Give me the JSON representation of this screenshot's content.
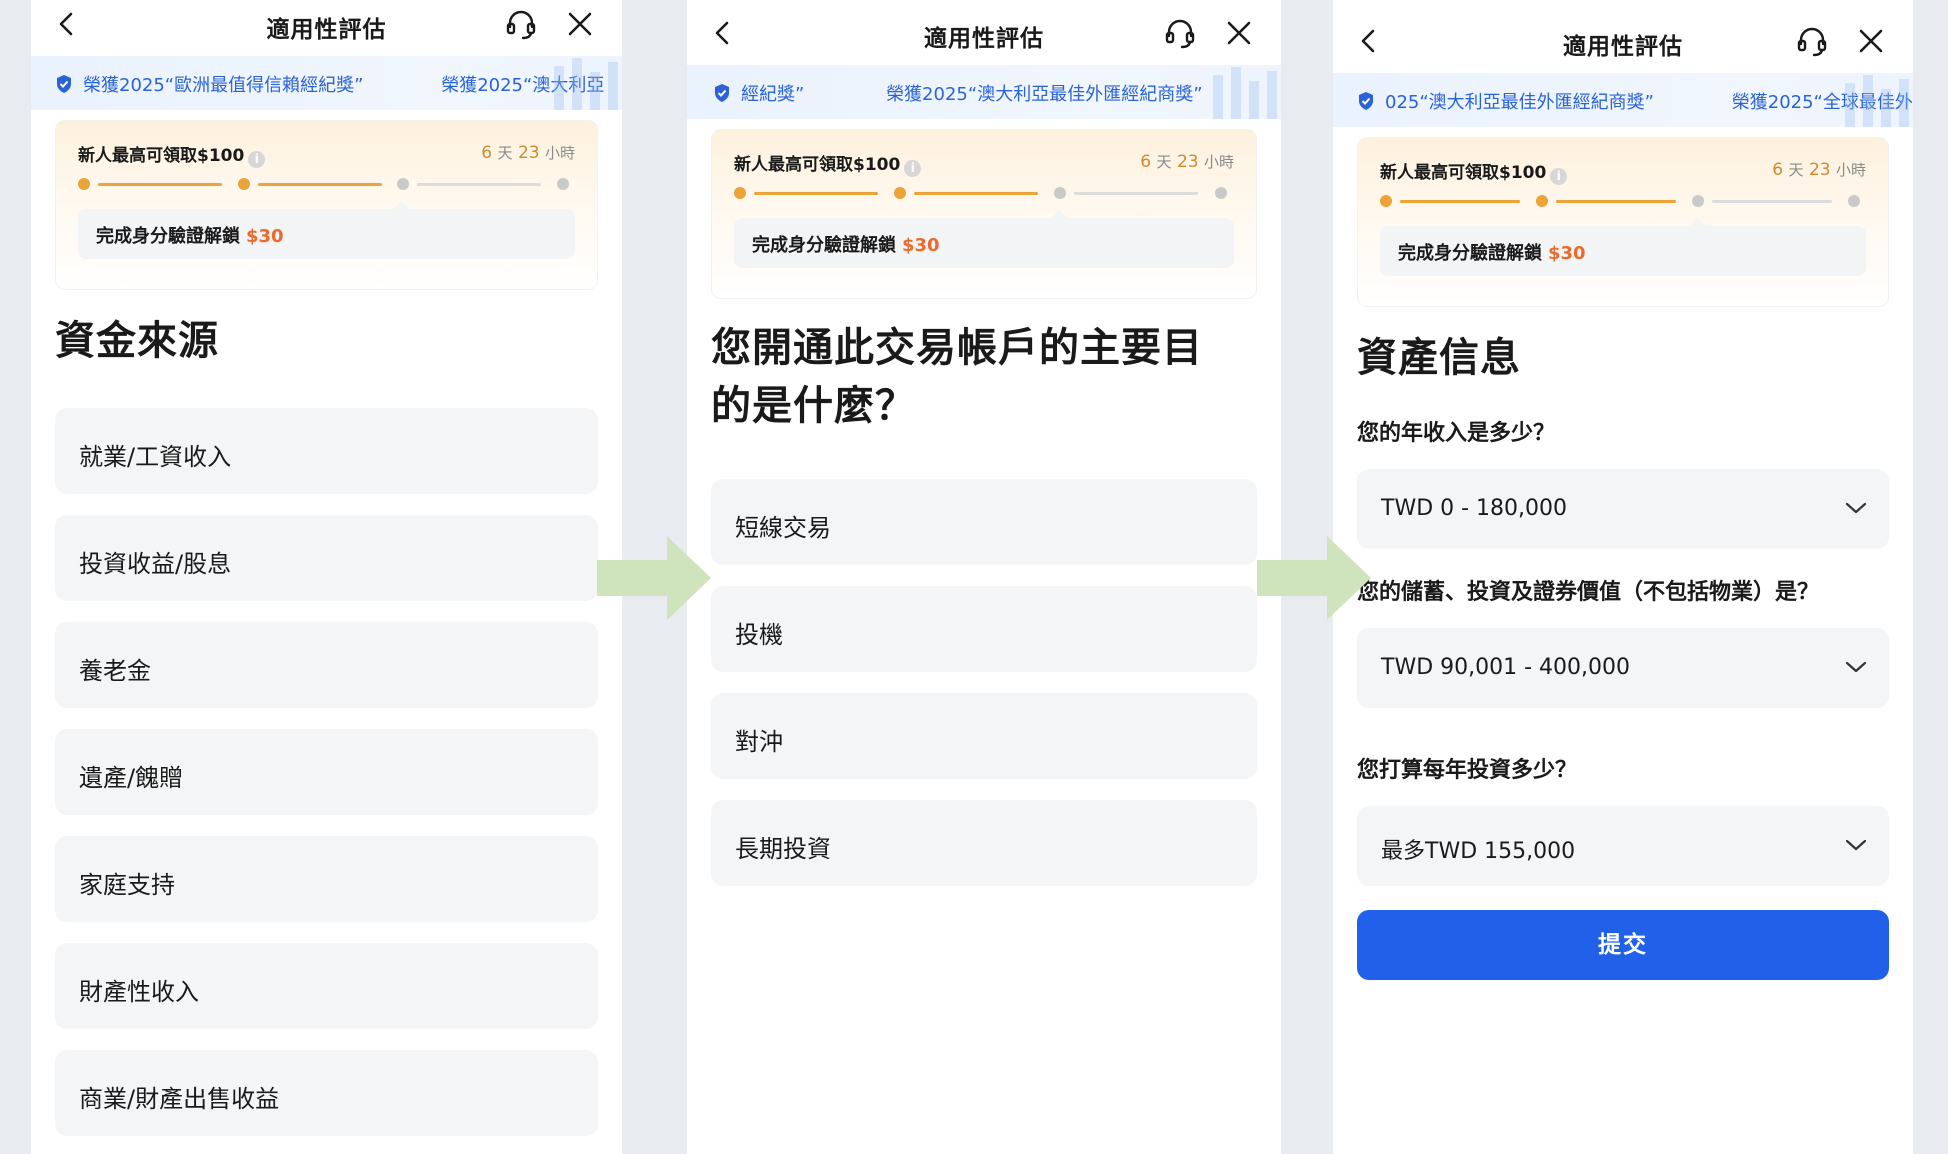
{
  "screen_title": "適用性評估",
  "marquee": {
    "panel1": [
      "榮獲2025“歐洲最值得信賴經紀獎”",
      "榮獲2025“澳大利亞"
    ],
    "panel2": [
      "經紀獎”",
      "榮獲2025“澳大利亞最佳外匯經紀商獎”"
    ],
    "panel3": [
      "025“澳大利亞最佳外匯經紀商獎”",
      "榮獲2025“全球最佳外"
    ]
  },
  "promo": {
    "headline": "新人最高可領取$100",
    "info_glyph": "i",
    "timer_days": "6",
    "timer_day_unit": "天",
    "timer_hours": "23",
    "timer_hour_unit": "小時",
    "unlock_text": "完成身分驗證解鎖",
    "unlock_amount": "$30",
    "progress_steps_done": 2,
    "progress_steps_total": 4
  },
  "panel1": {
    "heading": "資金來源",
    "options": [
      "就業/工資收入",
      "投資收益/股息",
      "養老金",
      "遺產/餽贈",
      "家庭支持",
      "財產性收入",
      "商業/財產出售收益"
    ]
  },
  "panel2": {
    "heading_line1": "您開通此交易帳戶的主要目",
    "heading_line2": "的是什麼？",
    "options": [
      "短線交易",
      "投機",
      "對沖",
      "長期投資"
    ]
  },
  "panel3": {
    "heading": "資產信息",
    "questions": [
      {
        "label": "您的年收入是多少？",
        "value": "TWD 0 - 180,000"
      },
      {
        "label": "您的儲蓄、投資及證券價值（不包括物業）是？",
        "value": "TWD 90,001 - 400,000"
      },
      {
        "label": "您打算每年投資多少？",
        "value": "最多TWD 155,000"
      }
    ],
    "submit_label": "提交"
  },
  "colors": {
    "accent_blue": "#2160e8",
    "link_blue": "#2a63d6",
    "progress_orange": "#eba33a",
    "progress_gray": "#c9c9c9",
    "reward_orange": "#ec6a2b",
    "flow_arrow": "#cfe3bd"
  },
  "icons": [
    "back-icon",
    "headset-icon",
    "close-icon",
    "shield-icon",
    "info-icon",
    "chevron-down-icon",
    "flow-arrow"
  ]
}
